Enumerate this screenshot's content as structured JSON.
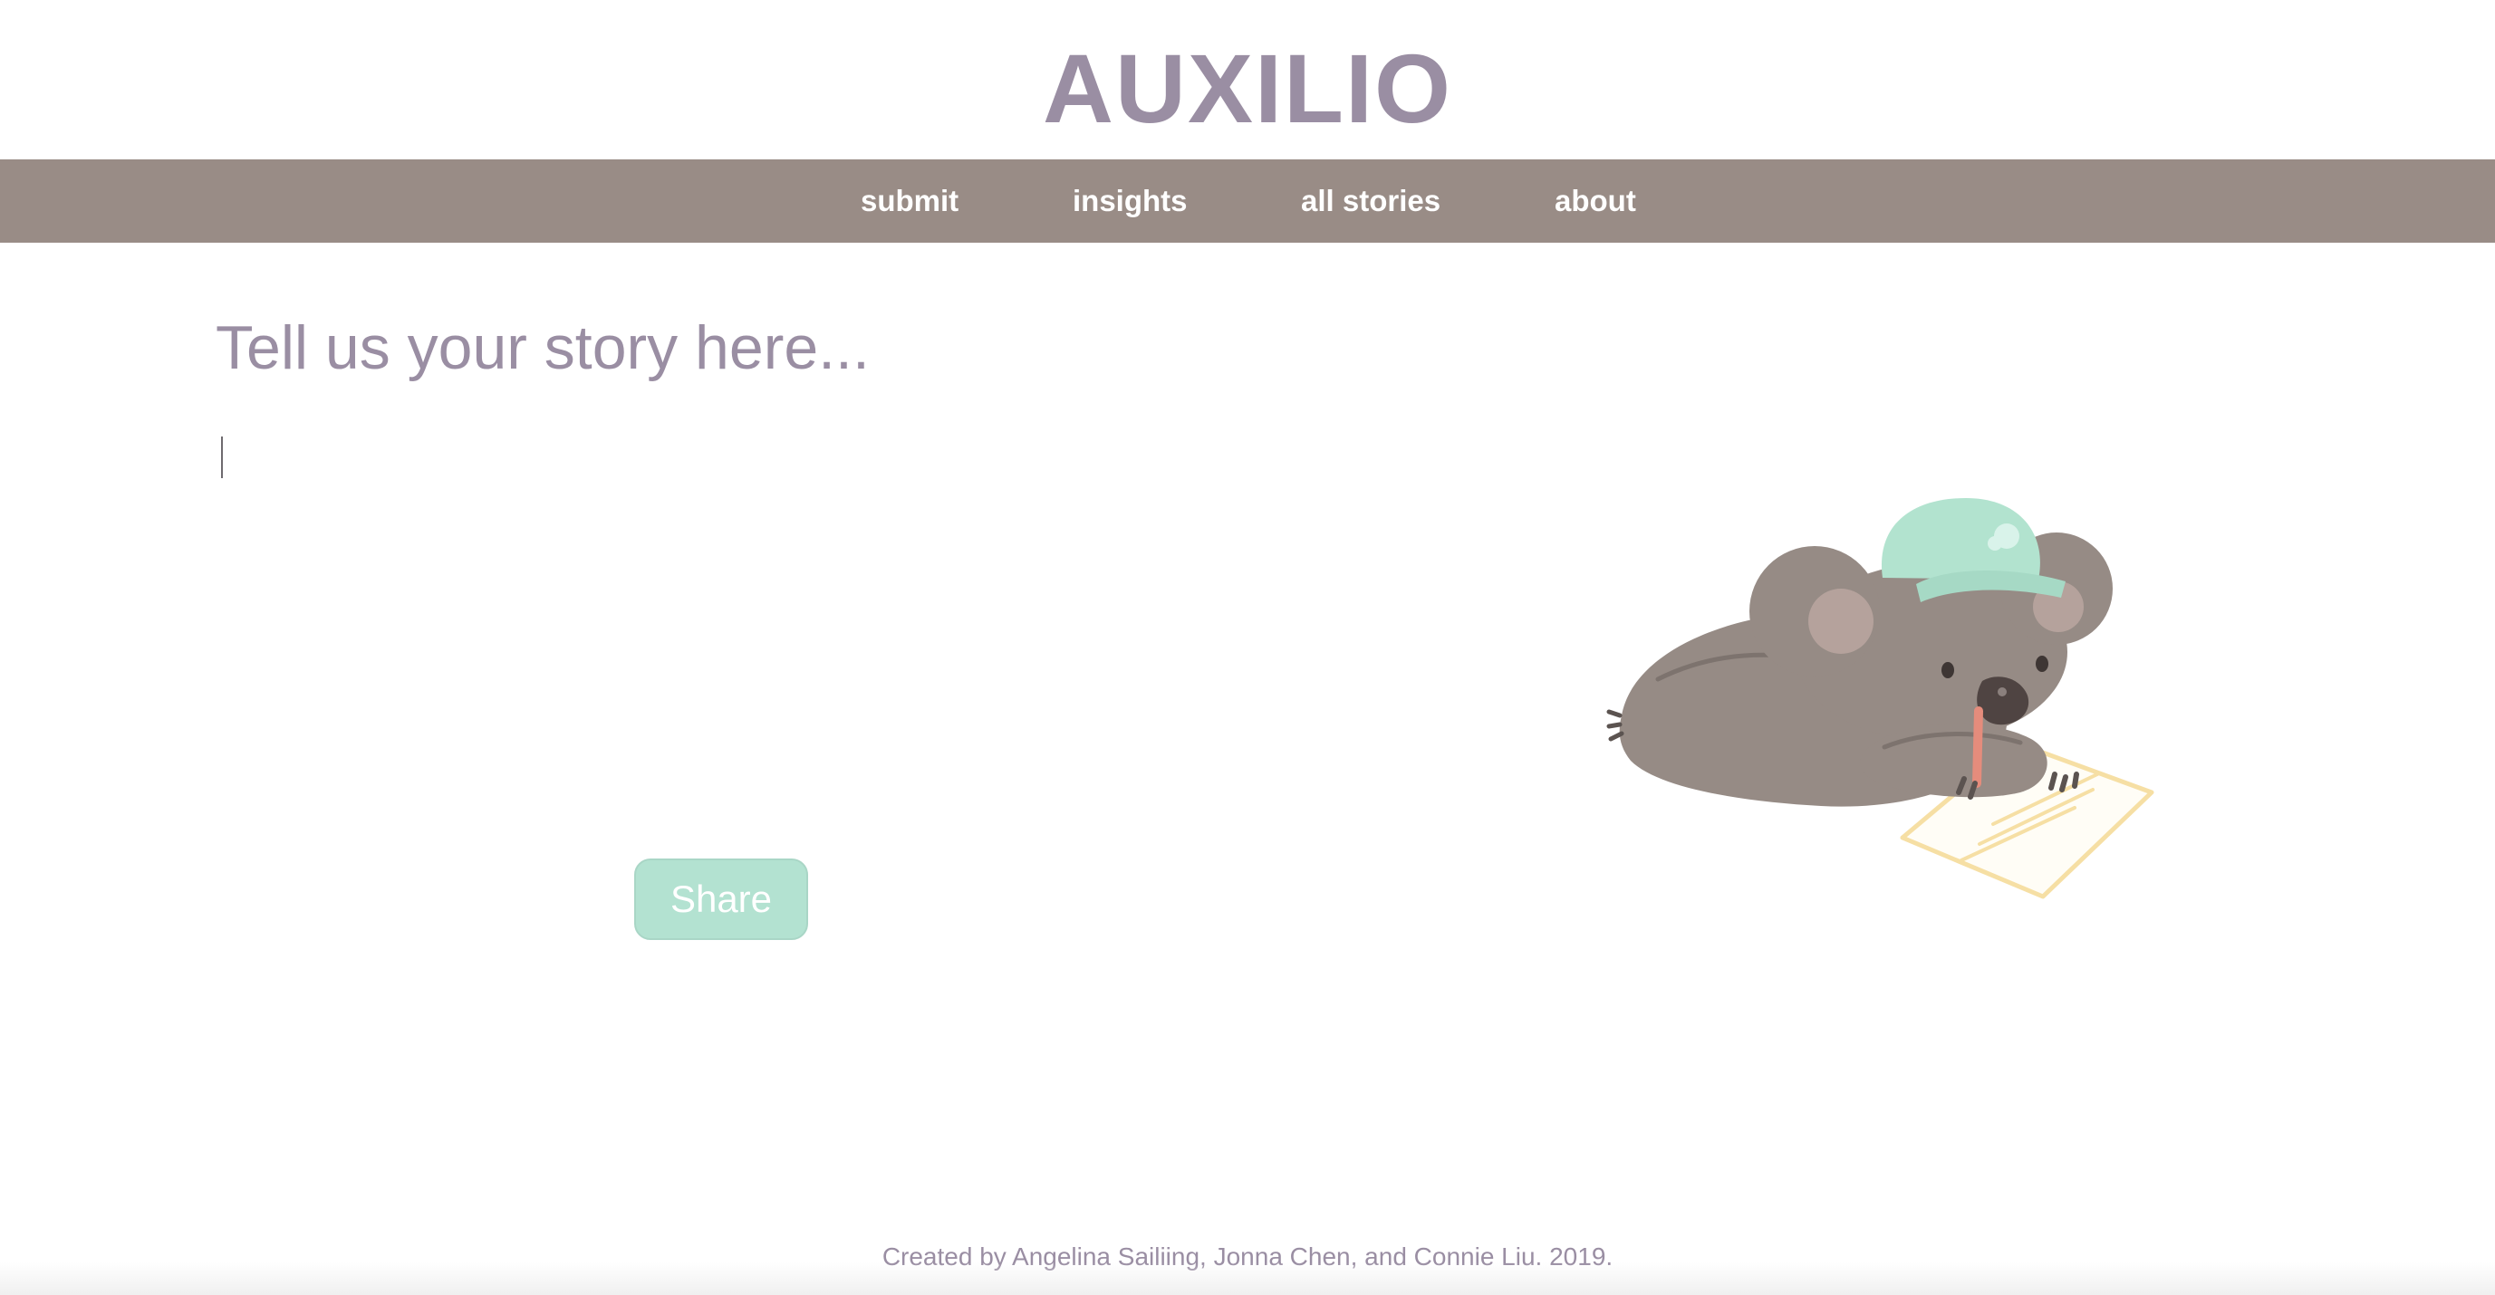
{
  "header": {
    "brand": "AUXILIO"
  },
  "nav": {
    "items": [
      {
        "label": "submit"
      },
      {
        "label": "insights"
      },
      {
        "label": "all stories"
      },
      {
        "label": "about"
      }
    ]
  },
  "form": {
    "prompt": "Tell us your story here...",
    "story_value": "",
    "share_label": "Share"
  },
  "illustration": {
    "icon": "koala-writing-illustration"
  },
  "footer": {
    "credit": "Created by Angelina Sailiing, Jonna Chen, and Connie Liu. 2019."
  },
  "colors": {
    "brand": "#9a8ea3",
    "navbar": "#998c86",
    "share_button": "#b3e2d1",
    "koala_fur": "#968b85",
    "hat": "#b2e3cf",
    "paper": "#f6dfa4"
  }
}
